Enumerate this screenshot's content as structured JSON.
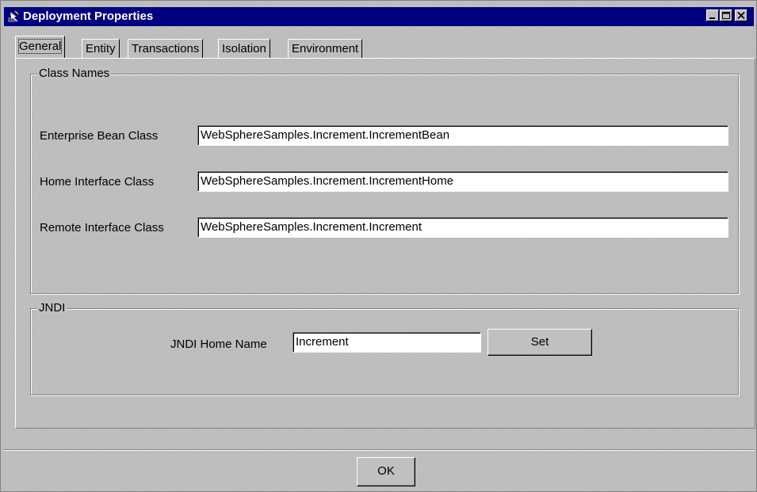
{
  "window": {
    "title": "Deployment Properties",
    "controls": [
      "minimize",
      "maximize",
      "close"
    ]
  },
  "tabs": [
    {
      "label": "General",
      "active": true
    },
    {
      "label": "Entity",
      "active": false
    },
    {
      "label": "Transactions",
      "active": false
    },
    {
      "label": "Isolation",
      "active": false
    },
    {
      "label": "Environment",
      "active": false
    }
  ],
  "class_names": {
    "legend": "Class Names",
    "enterprise_bean": {
      "label": "Enterprise Bean Class",
      "value": "WebSphereSamples.Increment.IncrementBean"
    },
    "home_interface": {
      "label": "Home Interface Class",
      "value": "WebSphereSamples.Increment.IncrementHome"
    },
    "remote_interface": {
      "label": "Remote Interface Class",
      "value": "WebSphereSamples.Increment.Increment"
    }
  },
  "jndi": {
    "legend": "JNDI",
    "home_name_label": "JNDI Home Name",
    "home_name_value": "Increment",
    "set_button": "Set"
  },
  "footer": {
    "ok_button": "OK"
  },
  "colors": {
    "titlebar": "#000080",
    "face": "#c0c0c0"
  }
}
